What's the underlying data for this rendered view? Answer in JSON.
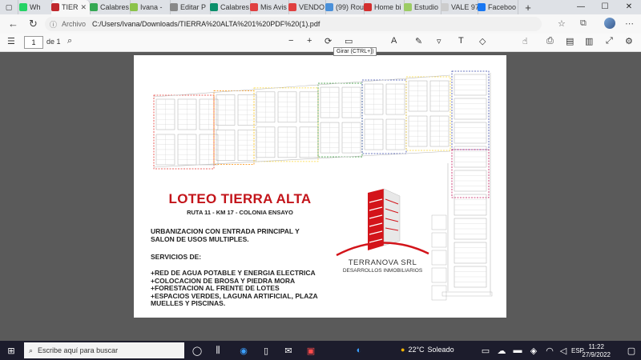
{
  "browser": {
    "tabs": [
      {
        "label": "Wh",
        "color": "#25d366"
      },
      {
        "label": "TIER",
        "color": "#c0282d",
        "active": true
      },
      {
        "label": "Calabres",
        "color": "#34a853"
      },
      {
        "label": "Ivana -",
        "color": "#8bc34a"
      },
      {
        "label": "Editar P",
        "color": "#888888"
      },
      {
        "label": "Calabres",
        "color": "#0b8f6a"
      },
      {
        "label": "Mis Avis",
        "color": "#e04040"
      },
      {
        "label": "VENDO",
        "color": "#e04040"
      },
      {
        "label": "(99) Rou",
        "color": "#4a90d9"
      },
      {
        "label": "Home bi",
        "color": "#d32f2f"
      },
      {
        "label": "Estudio",
        "color": "#9ccc65"
      },
      {
        "label": "VALE 97",
        "color": "#cccccc"
      },
      {
        "label": "Faceboo",
        "color": "#1877f2"
      }
    ],
    "new_tab": "+",
    "address": {
      "label": "Archivo",
      "path": "C:/Users/Ivana/Downloads/TIERRA%20ALTA%201%20PDF%20(1).pdf"
    }
  },
  "pdf": {
    "page_number": "1",
    "page_total": "de 1",
    "tooltip": "Girar (CTRL+])"
  },
  "document": {
    "title": "LOTEO TIERRA ALTA",
    "subtitle": "RUTA 11 - KM 17 - COLONIA ENSAYO",
    "intro": "URBANIZACION CON ENTRADA PRINCIPAL Y\nSALON DE USOS MULTIPLES.",
    "services_heading": "SERVICIOS DE:",
    "services": "+RED DE AGUA POTABLE Y ENERGIA ELECTRICA\n+COLOCACION DE BROSA Y PIEDRA MORA\n+FORESTACION AL FRENTE DE LOTES\n+ESPACIOS VERDES, LAGUNA ARTIFICIAL, PLAZA\nMUELLES Y PISCINAS.",
    "logo_name": "TERRANOVA SRL",
    "logo_sub": "DESARROLLOS INMOBILIARIOS",
    "brand_color": "#c3141a"
  },
  "taskbar": {
    "search_placeholder": "Escribe aquí para buscar",
    "weather_temp": "22°C",
    "weather_text": "Soleado",
    "language": "ESP",
    "time": "11:22",
    "date": "27/9/2022"
  }
}
